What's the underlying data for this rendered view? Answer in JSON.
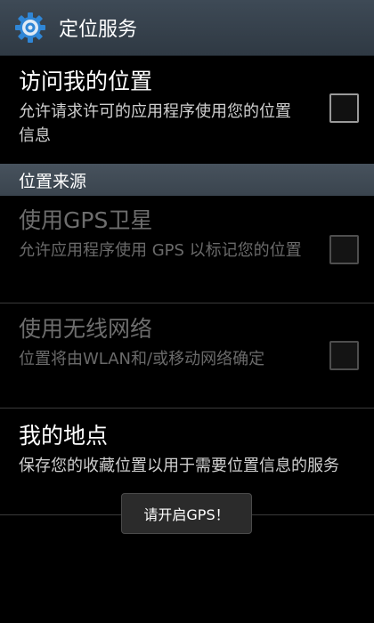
{
  "action_bar": {
    "title": "定位服务",
    "icon": "settings-gear-icon"
  },
  "items": [
    {
      "title": "访问我的位置",
      "summary": "允许请求许可的应用程序使用您的位置信息",
      "checked": false,
      "enabled": true
    },
    {
      "title": "使用GPS卫星",
      "summary": "允许应用程序使用 GPS 以标记您的位置",
      "checked": false,
      "enabled": false
    },
    {
      "title": "使用无线网络",
      "summary": "位置将由WLAN和/或移动网络确定",
      "checked": false,
      "enabled": false
    },
    {
      "title": "我的地点",
      "summary": "保存您的收藏位置以用于需要位置信息的服务",
      "enabled": true
    }
  ],
  "section_header": "位置来源",
  "toast": "请开启GPS！",
  "colors": {
    "action_bar": "#36414b",
    "section_header": "#414c57",
    "background": "#000000",
    "disabled_text": "#6d6d6d"
  }
}
